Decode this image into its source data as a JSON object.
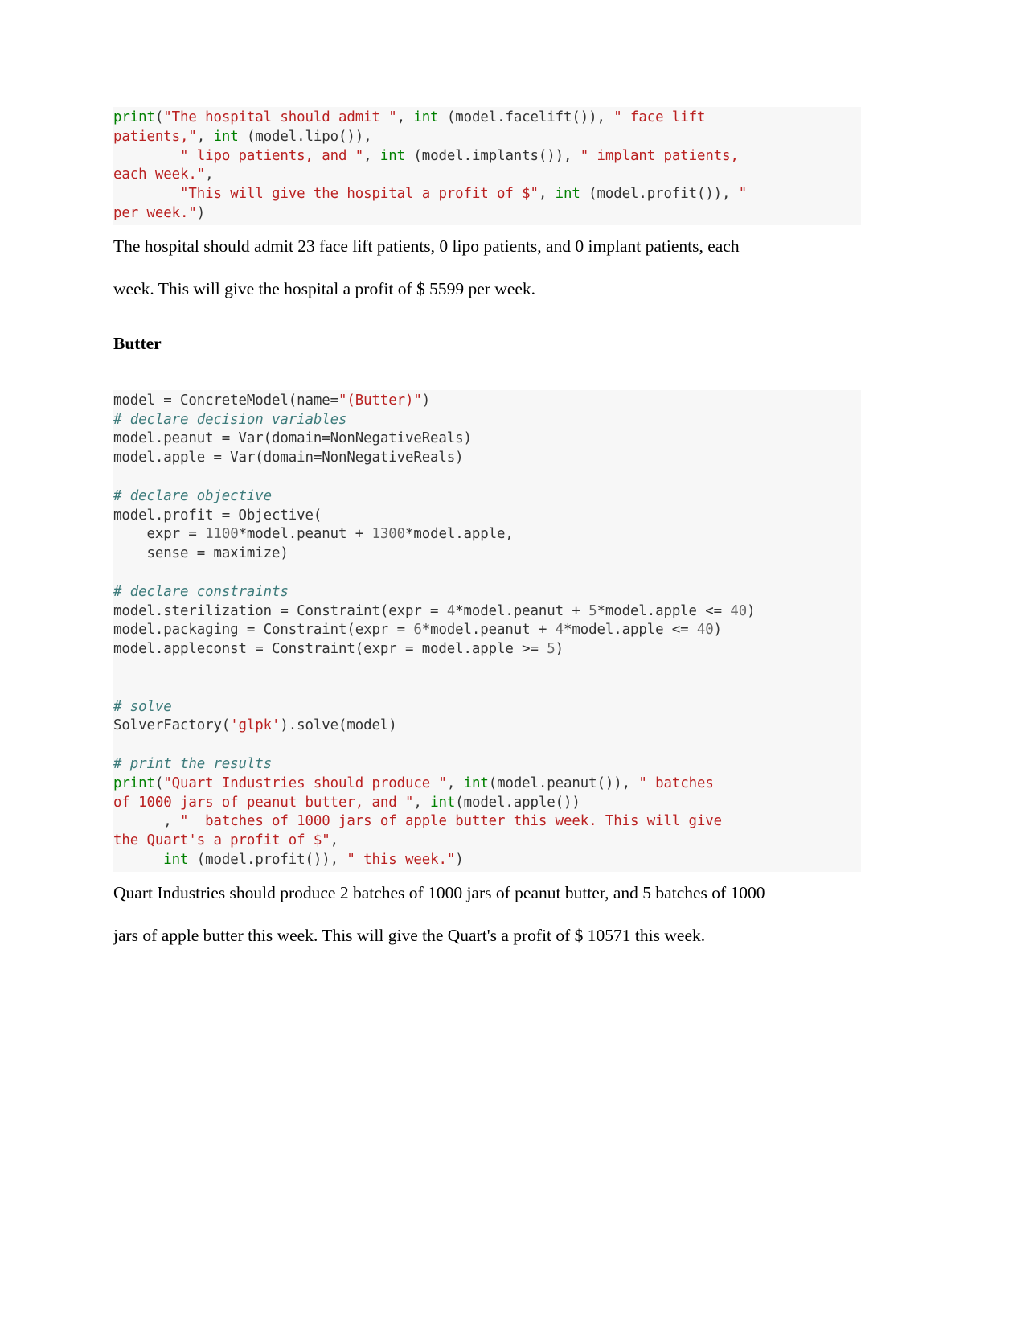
{
  "document": {
    "type": "python-notebook-export",
    "background_color": "#ffffff",
    "code_block_background": "#f7f7f7",
    "colors": {
      "string": "#ba2121",
      "keyword": "#008000",
      "comment": "#3d7b7b",
      "number": "#666666",
      "plain": "#333333",
      "body_text": "#000000"
    }
  },
  "blocks": {
    "hospital_print_code": {
      "lines": [
        [
          {
            "t": "print",
            "c": "fn"
          },
          {
            "t": "(",
            "c": "pl"
          },
          {
            "t": "\"The hospital should admit \"",
            "c": "str"
          },
          {
            "t": ", ",
            "c": "pl"
          },
          {
            "t": "int",
            "c": "kw"
          },
          {
            "t": " (model.facelift()), ",
            "c": "pl"
          },
          {
            "t": "\" face lift ",
            "c": "str"
          }
        ],
        [
          {
            "t": "patients,\"",
            "c": "str"
          },
          {
            "t": ", ",
            "c": "pl"
          },
          {
            "t": "int",
            "c": "kw"
          },
          {
            "t": " (model.lipo()),",
            "c": "pl"
          }
        ],
        [
          {
            "t": "        ",
            "c": "pl"
          },
          {
            "t": "\" lipo patients, and \"",
            "c": "str"
          },
          {
            "t": ", ",
            "c": "pl"
          },
          {
            "t": "int",
            "c": "kw"
          },
          {
            "t": " (model.implants()), ",
            "c": "pl"
          },
          {
            "t": "\" implant patients, ",
            "c": "str"
          }
        ],
        [
          {
            "t": "each week.\"",
            "c": "str"
          },
          {
            "t": ",",
            "c": "pl"
          }
        ],
        [
          {
            "t": "        ",
            "c": "pl"
          },
          {
            "t": "\"This will give the hospital a profit of $\"",
            "c": "str"
          },
          {
            "t": ", ",
            "c": "pl"
          },
          {
            "t": "int",
            "c": "kw"
          },
          {
            "t": " (model.profit()), ",
            "c": "pl"
          },
          {
            "t": "\" ",
            "c": "str"
          }
        ],
        [
          {
            "t": "per week.\"",
            "c": "str"
          },
          {
            "t": ")",
            "c": "pl"
          }
        ]
      ]
    },
    "hospital_output_line_1": "The hospital should admit  23  face lift patients, 0  lipo patients, and  0  implant patients, each",
    "hospital_output_line_2": "week. This will give the hospital a profit of $ 5599  per week.",
    "butter_heading": "Butter",
    "butter_code": {
      "lines": [
        [
          {
            "t": "model = ConcreteModel(name=",
            "c": "pl"
          },
          {
            "t": "\"(Butter)\"",
            "c": "str"
          },
          {
            "t": ")",
            "c": "pl"
          }
        ],
        [
          {
            "t": "# declare decision variables",
            "c": "com"
          }
        ],
        [
          {
            "t": "model.peanut = Var(domain=NonNegativeReals)",
            "c": "pl"
          }
        ],
        [
          {
            "t": "model.apple = Var(domain=NonNegativeReals)",
            "c": "pl"
          }
        ],
        [
          {
            "t": "",
            "c": "pl"
          }
        ],
        [
          {
            "t": "# declare objective",
            "c": "com"
          }
        ],
        [
          {
            "t": "model.profit = Objective(",
            "c": "pl"
          }
        ],
        [
          {
            "t": "    expr = ",
            "c": "pl"
          },
          {
            "t": "1100",
            "c": "num"
          },
          {
            "t": "*model.peanut + ",
            "c": "pl"
          },
          {
            "t": "1300",
            "c": "num"
          },
          {
            "t": "*model.apple,",
            "c": "pl"
          }
        ],
        [
          {
            "t": "    sense = maximize)",
            "c": "pl"
          }
        ],
        [
          {
            "t": "",
            "c": "pl"
          }
        ],
        [
          {
            "t": "# declare constraints",
            "c": "com"
          }
        ],
        [
          {
            "t": "model.sterilization = Constraint(expr = ",
            "c": "pl"
          },
          {
            "t": "4",
            "c": "num"
          },
          {
            "t": "*model.peanut + ",
            "c": "pl"
          },
          {
            "t": "5",
            "c": "num"
          },
          {
            "t": "*model.apple <= ",
            "c": "pl"
          },
          {
            "t": "40",
            "c": "num"
          },
          {
            "t": ")",
            "c": "pl"
          }
        ],
        [
          {
            "t": "model.packaging = Constraint(expr = ",
            "c": "pl"
          },
          {
            "t": "6",
            "c": "num"
          },
          {
            "t": "*model.peanut + ",
            "c": "pl"
          },
          {
            "t": "4",
            "c": "num"
          },
          {
            "t": "*model.apple <= ",
            "c": "pl"
          },
          {
            "t": "40",
            "c": "num"
          },
          {
            "t": ")",
            "c": "pl"
          }
        ],
        [
          {
            "t": "model.appleconst = Constraint(expr = model.apple >= ",
            "c": "pl"
          },
          {
            "t": "5",
            "c": "num"
          },
          {
            "t": ")",
            "c": "pl"
          }
        ],
        [
          {
            "t": "",
            "c": "pl"
          }
        ],
        [
          {
            "t": "",
            "c": "pl"
          }
        ],
        [
          {
            "t": "# solve",
            "c": "com"
          }
        ],
        [
          {
            "t": "SolverFactory(",
            "c": "pl"
          },
          {
            "t": "'glpk'",
            "c": "str"
          },
          {
            "t": ").solve(model)",
            "c": "pl"
          }
        ],
        [
          {
            "t": "",
            "c": "pl"
          }
        ],
        [
          {
            "t": "# print the results",
            "c": "com"
          }
        ],
        [
          {
            "t": "print",
            "c": "fn"
          },
          {
            "t": "(",
            "c": "pl"
          },
          {
            "t": "\"Quart Industries should produce \"",
            "c": "str"
          },
          {
            "t": ", ",
            "c": "pl"
          },
          {
            "t": "int",
            "c": "kw"
          },
          {
            "t": "(model.peanut()), ",
            "c": "pl"
          },
          {
            "t": "\" batches ",
            "c": "str"
          }
        ],
        [
          {
            "t": "of 1000 jars of peanut butter, and \"",
            "c": "str"
          },
          {
            "t": ", ",
            "c": "pl"
          },
          {
            "t": "int",
            "c": "kw"
          },
          {
            "t": "(model.apple())",
            "c": "pl"
          }
        ],
        [
          {
            "t": "      , ",
            "c": "pl"
          },
          {
            "t": "\"  batches of 1000 jars of apple butter this week. This will give ",
            "c": "str"
          }
        ],
        [
          {
            "t": "the Quart's a profit of $\"",
            "c": "str"
          },
          {
            "t": ",",
            "c": "pl"
          }
        ],
        [
          {
            "t": "      ",
            "c": "pl"
          },
          {
            "t": "int",
            "c": "kw"
          },
          {
            "t": " (model.profit()), ",
            "c": "pl"
          },
          {
            "t": "\" this week.\"",
            "c": "str"
          },
          {
            "t": ")",
            "c": "pl"
          }
        ]
      ]
    },
    "butter_output_line_1": "Quart Industries should produce 2 batches of 1000 jars of peanut butter, and 5   batches of 1000",
    "butter_output_line_2": "jars of apple butter this week. This will give the Quart's a profit of $ 10571 this week."
  }
}
